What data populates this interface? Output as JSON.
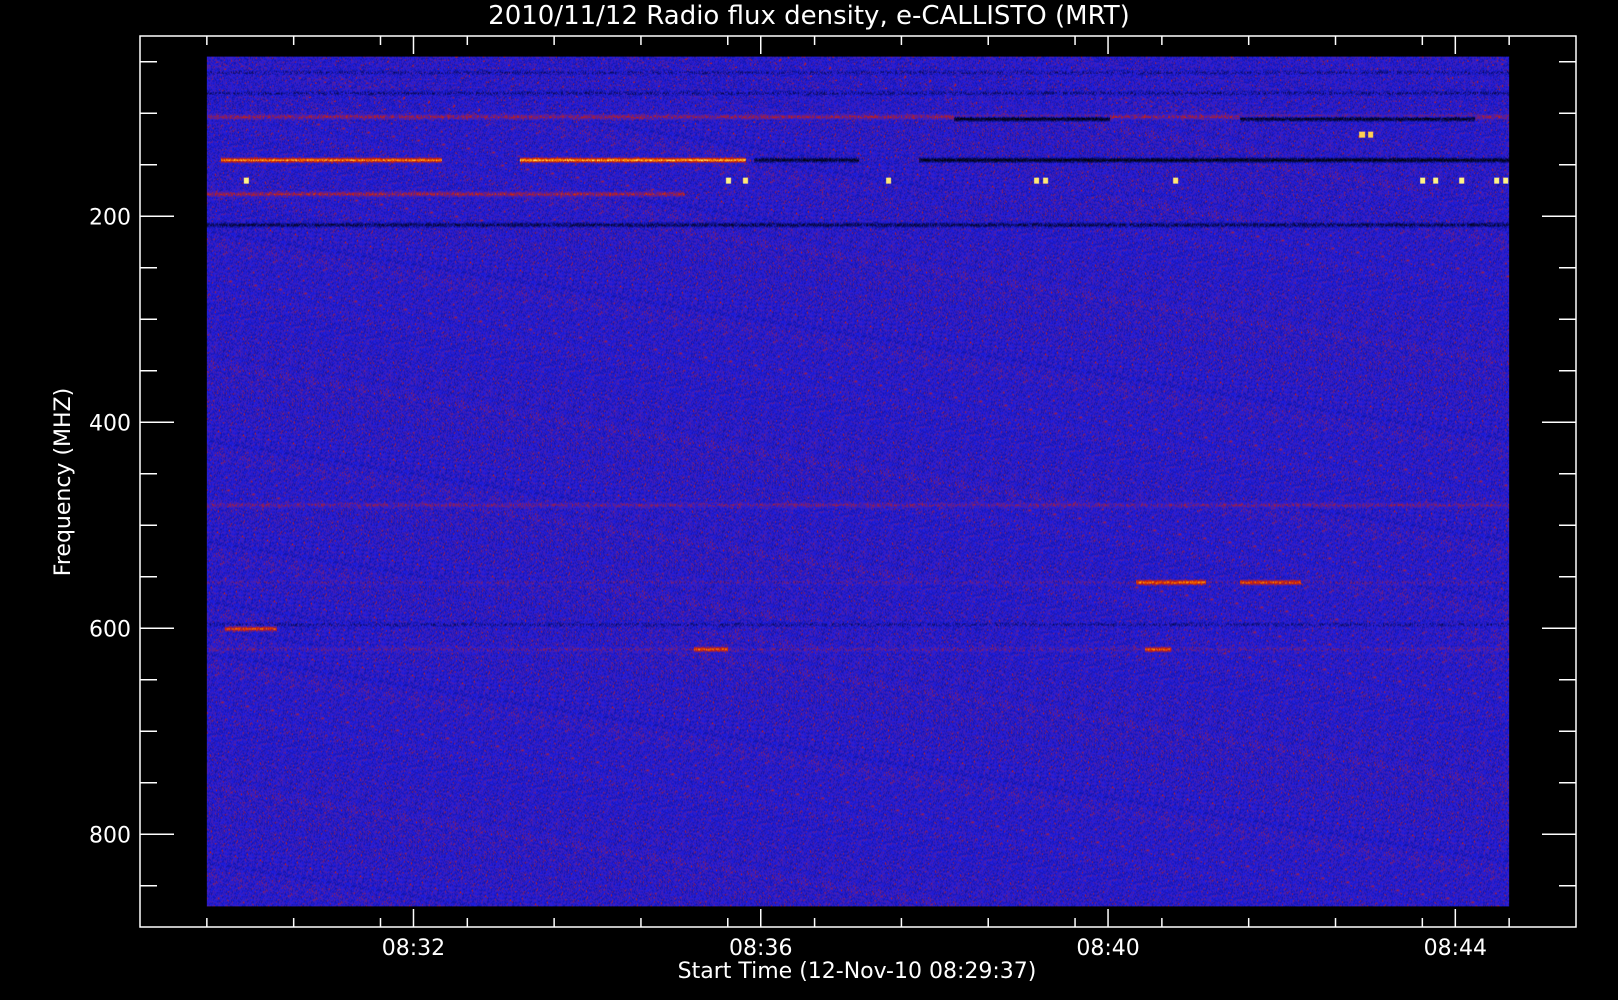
{
  "chart_data": {
    "type": "heatmap",
    "title": "2010/11/12  Radio flux density, e-CALLISTO (MRT)",
    "xlabel": "Start Time (12-Nov-10 08:29:37)",
    "ylabel": "Frequency (MHZ)",
    "x_tick_labels": [
      "08:32",
      "08:36",
      "08:40",
      "08:44"
    ],
    "y_tick_labels": [
      "200",
      "400",
      "600",
      "800"
    ],
    "y_ticks": [
      200,
      400,
      600,
      800
    ],
    "y_minor_ticks": [
      50,
      100,
      150,
      250,
      300,
      350,
      450,
      500,
      550,
      650,
      700,
      750,
      850
    ],
    "y_reversed": true,
    "frequency_range_mhz": [
      45,
      870
    ],
    "axis_range_mhz": [
      25,
      890
    ],
    "time_range_min": [
      0.0,
      15.0
    ],
    "axis_time_range_min": [
      -0.77,
      15.77
    ],
    "x_tick_times_min": [
      2.38,
      6.38,
      10.38,
      14.38
    ],
    "x_minor_tick_times_min": [
      0.0,
      1.0,
      2.0,
      3.0,
      4.0,
      5.0,
      6.0,
      7.0,
      8.0,
      9.0,
      10.0,
      11.0,
      12.0,
      13.0,
      14.0,
      15.0
    ],
    "colormap": [
      "#000000",
      "#0a0a5a",
      "#1e1ee6",
      "#d21e00",
      "#ff9600",
      "#ffff96"
    ],
    "background_level": 0.36,
    "bands": [
      {
        "freq": 60,
        "start": 0.0,
        "end": 15.0,
        "level": 0.3
      },
      {
        "freq": 80,
        "start": 0.0,
        "end": 15.0,
        "level": 0.28
      },
      {
        "freq": 103,
        "start": 0.0,
        "end": 15.0,
        "level": 0.52
      },
      {
        "freq": 105,
        "start": 8.6,
        "end": 10.4,
        "level": 0.04
      },
      {
        "freq": 105,
        "start": 11.9,
        "end": 14.6,
        "level": 0.08
      },
      {
        "freq": 145,
        "start": 0.15,
        "end": 2.7,
        "level": 0.8
      },
      {
        "freq": 145,
        "start": 3.6,
        "end": 6.2,
        "level": 0.86
      },
      {
        "freq": 145,
        "start": 6.3,
        "end": 7.5,
        "level": 0.1
      },
      {
        "freq": 145,
        "start": 8.2,
        "end": 15.0,
        "level": 0.06
      },
      {
        "freq": 178,
        "start": 0.0,
        "end": 5.5,
        "level": 0.55
      },
      {
        "freq": 208,
        "start": 0.0,
        "end": 15.0,
        "level": 0.18
      },
      {
        "freq": 480,
        "start": 0.0,
        "end": 15.0,
        "level": 0.46
      },
      {
        "freq": 555,
        "start": 0.0,
        "end": 15.0,
        "level": 0.4
      },
      {
        "freq": 555,
        "start": 10.7,
        "end": 11.5,
        "level": 0.78
      },
      {
        "freq": 555,
        "start": 11.9,
        "end": 12.6,
        "level": 0.72
      },
      {
        "freq": 596,
        "start": 0.0,
        "end": 15.0,
        "level": 0.3
      },
      {
        "freq": 600,
        "start": 0.2,
        "end": 0.8,
        "level": 0.7
      },
      {
        "freq": 620,
        "start": 0.0,
        "end": 15.0,
        "level": 0.42
      },
      {
        "freq": 620,
        "start": 5.6,
        "end": 6.0,
        "level": 0.74
      },
      {
        "freq": 620,
        "start": 10.8,
        "end": 11.1,
        "level": 0.74
      }
    ],
    "bursts": [
      {
        "freq": 165,
        "time": 0.45,
        "level": 0.98
      },
      {
        "freq": 165,
        "time": 6.0,
        "level": 0.98
      },
      {
        "freq": 165,
        "time": 6.2,
        "level": 0.96
      },
      {
        "freq": 165,
        "time": 7.85,
        "level": 0.96
      },
      {
        "freq": 165,
        "time": 9.55,
        "level": 0.96
      },
      {
        "freq": 165,
        "time": 9.65,
        "level": 0.96
      },
      {
        "freq": 165,
        "time": 11.15,
        "level": 0.96
      },
      {
        "freq": 165,
        "time": 14.0,
        "level": 0.98
      },
      {
        "freq": 165,
        "time": 14.15,
        "level": 0.98
      },
      {
        "freq": 165,
        "time": 14.45,
        "level": 0.98
      },
      {
        "freq": 165,
        "time": 14.85,
        "level": 0.98
      },
      {
        "freq": 165,
        "time": 14.95,
        "level": 0.98
      },
      {
        "freq": 120,
        "time": 13.3,
        "level": 0.92
      },
      {
        "freq": 120,
        "time": 13.4,
        "level": 0.92
      }
    ]
  }
}
